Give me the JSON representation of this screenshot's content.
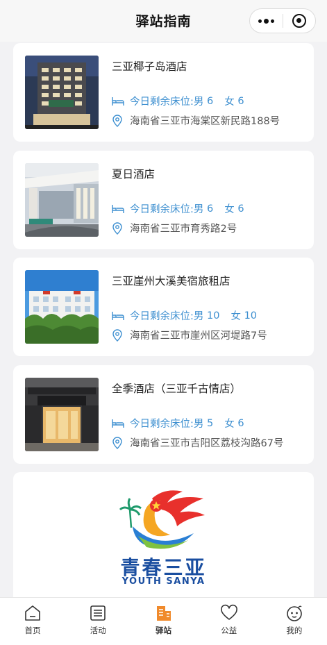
{
  "navbar": {
    "title": "驿站指南",
    "more_icon": "more-dots-icon",
    "close_icon": "target-close-icon"
  },
  "hotels": [
    {
      "name": "三亚椰子岛酒店",
      "beds_label": "今日剩余床位:",
      "male_label": "男",
      "male": "6",
      "female_label": "女",
      "female": "6",
      "address": "海南省三亚市海棠区新民路188号"
    },
    {
      "name": "夏日酒店",
      "beds_label": "今日剩余床位:",
      "male_label": "男",
      "male": "6",
      "female_label": "女",
      "female": "6",
      "address": "海南省三亚市育秀路2号"
    },
    {
      "name": "三亚崖州大溪美宿旅租店",
      "beds_label": "今日剩余床位:",
      "male_label": "男",
      "male": "10",
      "female_label": "女",
      "female": "10",
      "address": "海南省三亚市崖州区河堤路7号"
    },
    {
      "name": "全季酒店（三亚千古情店）",
      "beds_label": "今日剩余床位:",
      "male_label": "男",
      "male": "5",
      "female_label": "女",
      "female": "6",
      "address": "海南省三亚市吉阳区荔枝沟路67号"
    }
  ],
  "banner": {
    "cn": "青春三亚",
    "en": "YOUTH SANYA"
  },
  "tabs": [
    {
      "label": "首页",
      "icon": "home-icon"
    },
    {
      "label": "活动",
      "icon": "list-icon"
    },
    {
      "label": "驿站",
      "icon": "building-icon",
      "active": true
    },
    {
      "label": "公益",
      "icon": "heart-icon"
    },
    {
      "label": "我的",
      "icon": "face-icon"
    }
  ],
  "colors": {
    "accent": "#3d8fd0",
    "active_tab": "#f08a2c"
  }
}
